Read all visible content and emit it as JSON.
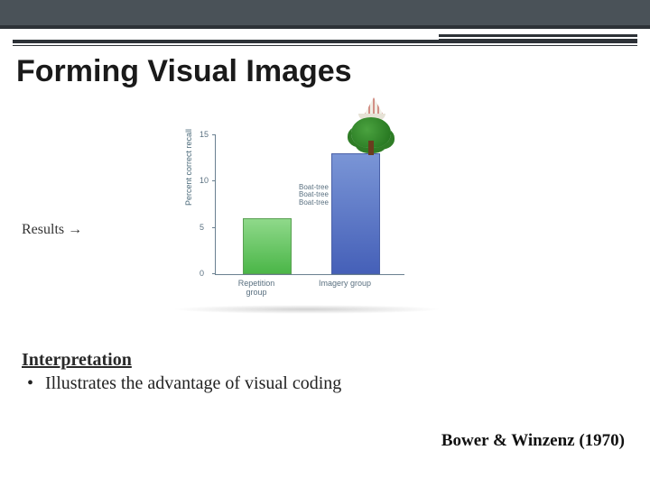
{
  "slide": {
    "title": "Forming Visual Images",
    "results_label": "Results →",
    "interpretation_heading": "Interpretation",
    "bullet_text": "Illustrates the advantage of visual coding",
    "citation": "Bower & Winzenz (1970)"
  },
  "chart_data": {
    "type": "bar",
    "ylabel": "Percent correct recall",
    "ylim": [
      0,
      15
    ],
    "yticks": [
      0,
      5,
      10,
      15
    ],
    "categories": [
      "Repetition group",
      "Imagery group"
    ],
    "values": [
      6,
      13
    ],
    "repetition_cue_lines": [
      "Boat-tree",
      "Boat-tree",
      "Boat-tree"
    ],
    "imagery_cue": "tree-with-sailboat-image",
    "colors": {
      "repetition": "#4bb648",
      "imagery": "#4560b8"
    }
  }
}
